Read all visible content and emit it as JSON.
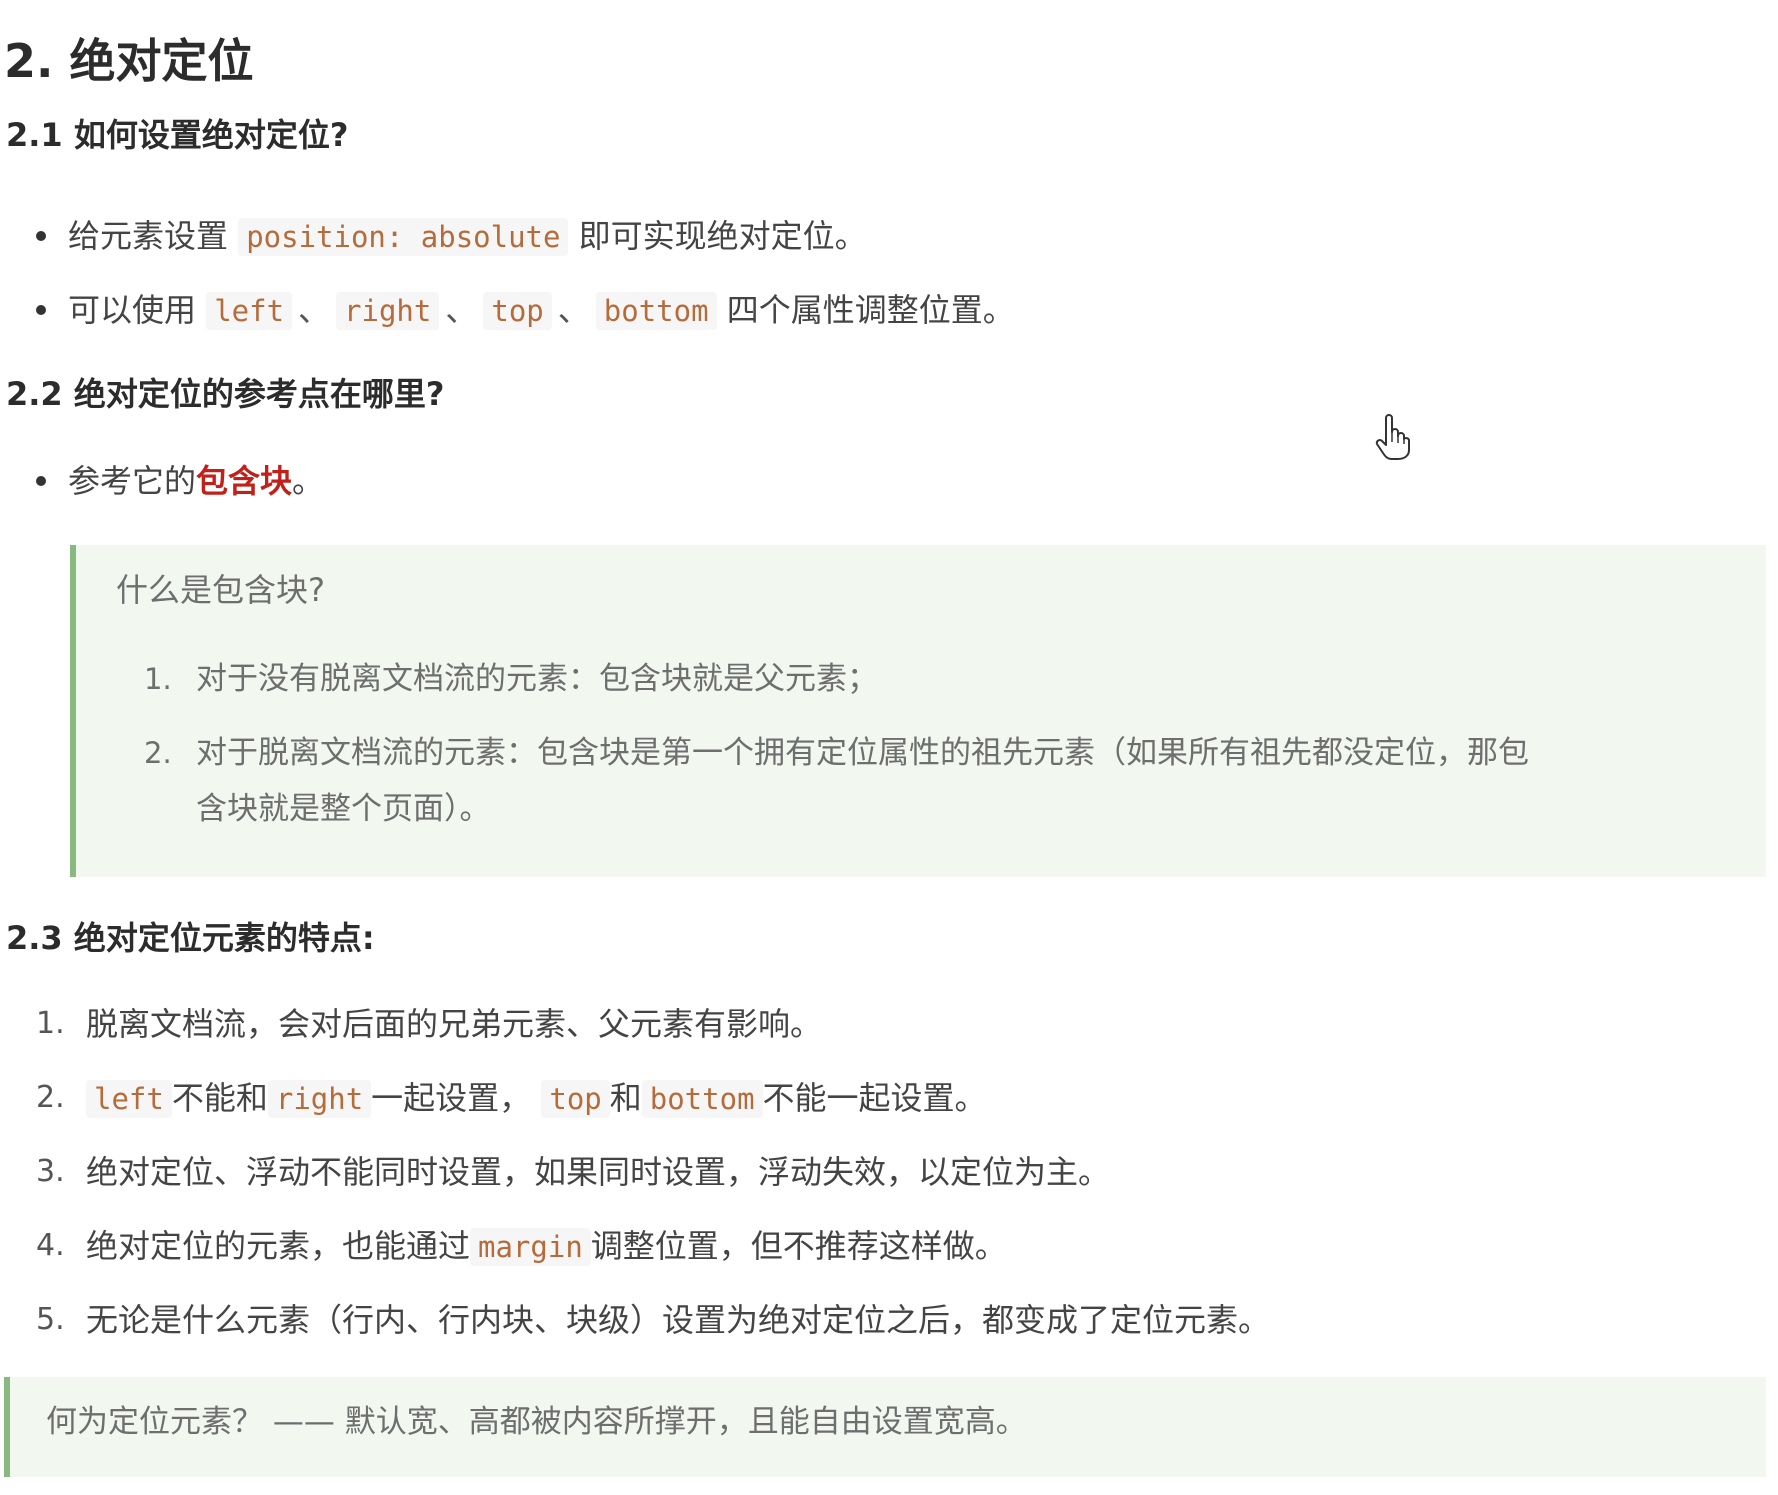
{
  "section_title": "2. 绝对定位",
  "s21": {
    "heading": "2.1 如何设置绝对定位?",
    "item1": {
      "pre": "给元素设置",
      "code": "position: absolute",
      "post": "即可实现绝对定位。"
    },
    "item2": {
      "pre": "可以使用",
      "code1": "left",
      "sep1": "、",
      "code2": "right",
      "sep2": "、",
      "code3": "top",
      "sep3": "、",
      "code4": "bottom",
      "post": "四个属性调整位置。"
    }
  },
  "s22": {
    "heading": "2.2 绝对定位的参考点在哪里?",
    "item1": {
      "pre": "参考它的",
      "em": "包含块",
      "post": "。"
    },
    "quote": {
      "title": "什么是包含块?",
      "items": [
        {
          "num": "1.",
          "text": "对于没有脱离文档流的元素：包含块就是父元素；"
        },
        {
          "num": "2.",
          "line1": "对于脱离文档流的元素：包含块是第一个拥有定位属性的祖先元素（如果所有祖先都没定位，那包",
          "line2": "含块就是整个页面）。"
        }
      ]
    }
  },
  "s23": {
    "heading": "2.3 绝对定位元素的特点:",
    "items": [
      {
        "num": "1.",
        "text": "脱离文档流，会对后面的兄弟元素、父元素有影响。"
      },
      {
        "num": "2.",
        "code1": "left",
        "t1": "不能和",
        "code2": "right",
        "t2": "一起设置，",
        "code3": "top",
        "t3": "和",
        "code4": "bottom",
        "t4": "不能一起设置。"
      },
      {
        "num": "3.",
        "text": "绝对定位、浮动不能同时设置，如果同时设置，浮动失效，以定位为主。"
      },
      {
        "num": "4.",
        "pre": "绝对定位的元素，也能通过",
        "code": "margin",
        "post": "调整位置，但不推荐这样做。"
      },
      {
        "num": "5.",
        "text": "无论是什么元素（行内、行内块、块级）设置为绝对定位之后，都变成了定位元素。"
      }
    ],
    "note": "何为定位元素？ —— 默认宽、高都被内容所撑开，且能自由设置宽高。"
  },
  "colors": {
    "code_text": "#b66b3a",
    "emphasis_red": "#c0211a",
    "quote_bg": "#f2f7f0",
    "quote_border": "#88b97e"
  },
  "icons": {
    "cursor": "hand-pointer-icon"
  }
}
